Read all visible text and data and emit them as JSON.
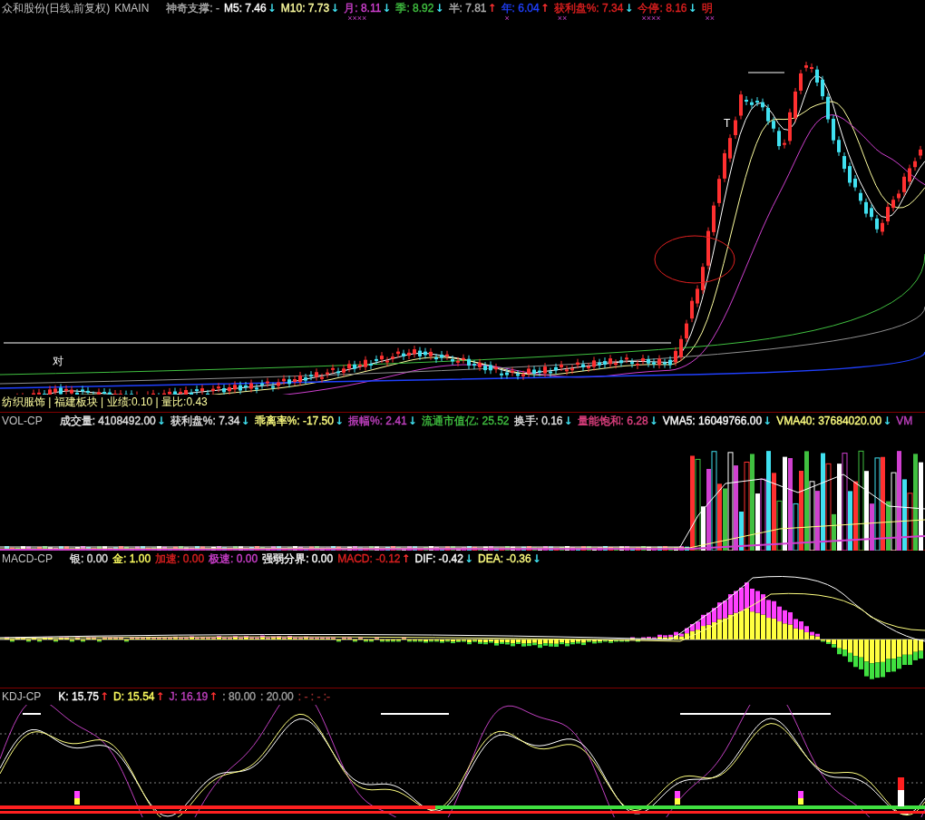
{
  "main": {
    "title": "众和股份(日线,前复权)",
    "indicator": "KMAIN",
    "legend": [
      {
        "text": "神奇支撑: -",
        "color": "#a8a8a8"
      },
      {
        "text": "M5: 7.46",
        "color": "#ffffff",
        "arrow": "↓",
        "rising": false
      },
      {
        "text": "M10: 7.73",
        "color": "#ffffa0",
        "arrow": "↓",
        "rising": false
      },
      {
        "text": "月: 8.11",
        "color": "#d040d0",
        "arrow": "↓",
        "rising": false,
        "tag": "××××"
      },
      {
        "text": "季: 8.92",
        "color": "#40c040",
        "arrow": "↓",
        "rising": false
      },
      {
        "text": "半: 7.81",
        "color": "#b0b0b0",
        "arrow": "↑",
        "rising": true
      },
      {
        "text": "年: 6.04",
        "color": "#2040ff",
        "arrow": "↑",
        "rising": true,
        "tag": "×"
      },
      {
        "text": "获利盘%: 7.34",
        "color": "#e02020",
        "arrow": "↓",
        "rising": false,
        "tag": "××"
      },
      {
        "text": "今停: 8.16",
        "color": "#e02020",
        "arrow": "↓",
        "rising": false,
        "tag": "××××"
      },
      {
        "text": "明",
        "color": "#e02020",
        "tag": "××"
      }
    ],
    "chart_labels": [
      "对",
      "T"
    ],
    "sector_line": "纺织服饰 | 福建板块 | 业绩:0.10 | 量比:0.43"
  },
  "volume": {
    "indicator": "VOL-CP",
    "legend": [
      {
        "text": "成交量: 4108492.00",
        "color": "#e0e0e0",
        "arrow": "↓",
        "rising": false
      },
      {
        "text": "获利盘%: 7.34",
        "color": "#e0e0e0",
        "arrow": "↓",
        "rising": false
      },
      {
        "text": "乖离率%: -17.50",
        "color": "#ffff80",
        "arrow": "↓",
        "rising": false
      },
      {
        "text": "振幅%: 2.41",
        "color": "#c040c0",
        "arrow": "↓",
        "rising": false
      },
      {
        "text": "流通市值亿: 25.52",
        "color": "#40c040"
      },
      {
        "text": "换手: 0.16",
        "color": "#e0e0e0",
        "arrow": "↓",
        "rising": false
      },
      {
        "text": "量能饱和: 6.28",
        "color": "#e04080",
        "arrow": "↓",
        "rising": false
      },
      {
        "text": "VMA5: 16049766.00",
        "color": "#ffffff",
        "arrow": "↓",
        "rising": false
      },
      {
        "text": "VMA40: 37684020.00",
        "color": "#ffff80",
        "arrow": "↓",
        "rising": false
      },
      {
        "text": "VM",
        "color": "#c040c0"
      }
    ]
  },
  "macd": {
    "indicator": "MACD-CP",
    "legend": [
      {
        "text": "银: 0.00",
        "color": "#e0e0e0"
      },
      {
        "text": "金: 1.00",
        "color": "#ffff60"
      },
      {
        "text": "加速: 0.00",
        "color": "#e02020"
      },
      {
        "text": "极速: 0.00",
        "color": "#d040d0"
      },
      {
        "text": "强弱分界: 0.00",
        "color": "#ffffff"
      },
      {
        "text": "MACD: -0.12",
        "color": "#e02020",
        "arrow": "↑",
        "rising": true
      },
      {
        "text": "DIF: -0.42",
        "color": "#ffffff",
        "arrow": "↓",
        "rising": false
      },
      {
        "text": "DEA: -0.36",
        "color": "#ffff80",
        "arrow": "↓",
        "rising": false
      }
    ]
  },
  "kdj": {
    "indicator": "KDJ-CP",
    "legend": [
      {
        "text": "K: 15.75",
        "color": "#ffffff",
        "arrow": "↑",
        "rising": true
      },
      {
        "text": "D: 15.54",
        "color": "#ffff60",
        "arrow": "↑",
        "rising": true
      },
      {
        "text": "J: 16.19",
        "color": "#c040c0",
        "arrow": "↑",
        "rising": true
      },
      {
        "text": ": 80.00",
        "color": "#a0a0a0"
      },
      {
        "text": ": 20.00",
        "color": "#a0a0a0"
      },
      {
        "text": ": - : - :-",
        "color": "#a03030"
      }
    ]
  }
}
